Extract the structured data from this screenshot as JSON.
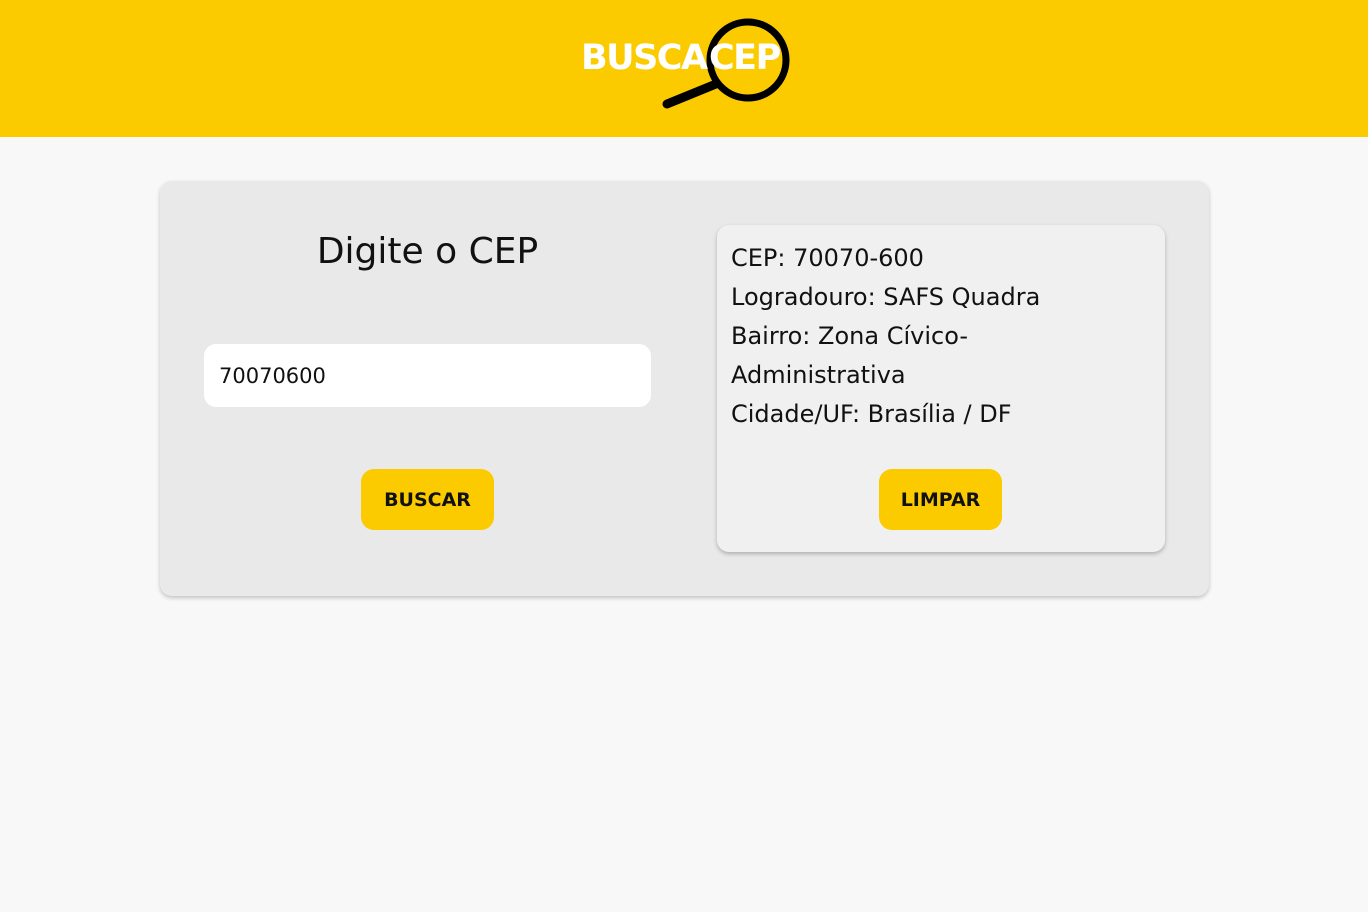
{
  "header": {
    "logo_part1": "BUSCA",
    "logo_part2": "CEP",
    "brand_color": "#fbcb00"
  },
  "form": {
    "title": "Digite o CEP",
    "cep_value": "70070600",
    "search_button": "BUSCAR"
  },
  "result": {
    "cep": "CEP: 70070-600",
    "logradouro": "Logradouro: SAFS Quadra",
    "bairro_line1": "Bairro: Zona Cívico-",
    "bairro_line2": "Administrativa",
    "cidade": "Cidade/UF: Brasília / DF",
    "clear_button": "LIMPAR"
  }
}
